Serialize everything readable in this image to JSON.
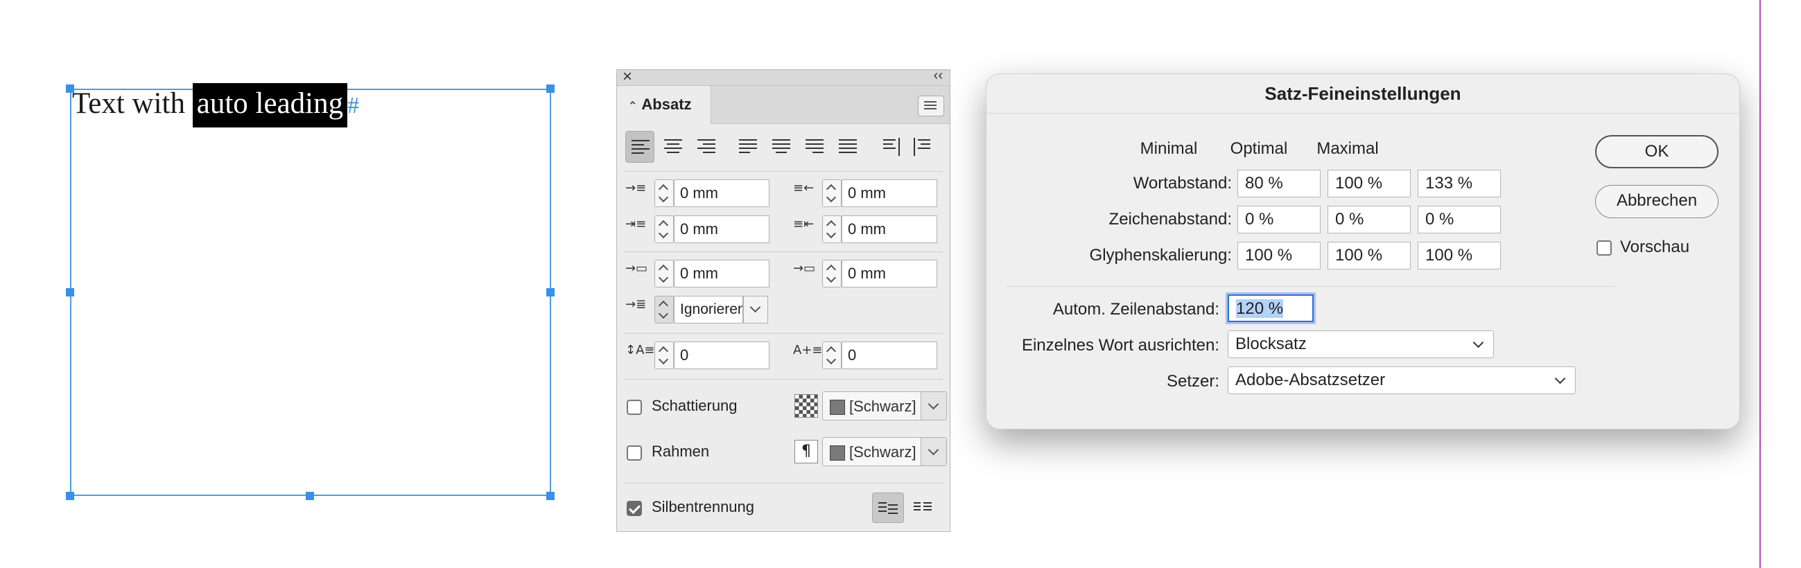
{
  "canvas": {
    "text_before": "Text with",
    "text_selected": "auto leading",
    "text_after": "",
    "paragraph_mark": "#"
  },
  "panel": {
    "tab": "Absatz",
    "indent_left": "0 mm",
    "indent_right": "0 mm",
    "first_line_indent": "0 mm",
    "last_line_indent": "0 mm",
    "space_before": "0 mm",
    "space_after": "0 mm",
    "align_to_grid": "Ignorieren",
    "drop_cap_lines": "0",
    "drop_cap_chars": "0",
    "shading_label": "Schattierung",
    "shading_color": "[Schwarz]",
    "border_label": "Rahmen",
    "border_color": "[Schwarz]",
    "hyphenation_label": "Silbentrennung",
    "hyphenation_checked": true,
    "shading_checked": false,
    "border_checked": false
  },
  "dialog": {
    "title": "Satz-Feineinstellungen",
    "columns": [
      "Minimal",
      "Optimal",
      "Maximal"
    ],
    "rows": [
      {
        "label": "Wortabstand:",
        "values": [
          "80 %",
          "100 %",
          "133 %"
        ]
      },
      {
        "label": "Zeichenabstand:",
        "values": [
          "0 %",
          "0 %",
          "0 %"
        ]
      },
      {
        "label": "Glyphenskalierung:",
        "values": [
          "100 %",
          "100 %",
          "100 %"
        ]
      }
    ],
    "auto_leading_label": "Autom. Zeilenabstand:",
    "auto_leading_value": "120 %",
    "single_word_label": "Einzelnes Wort ausrichten:",
    "single_word_value": "Blocksatz",
    "composer_label": "Setzer:",
    "composer_value": "Adobe-Absatzsetzer",
    "ok": "OK",
    "cancel": "Abbrechen",
    "preview": "Vorschau"
  },
  "colors": {
    "frame": "#4a9ee0",
    "focus": "#2e6fd6",
    "page_guide": "#b34db3"
  }
}
